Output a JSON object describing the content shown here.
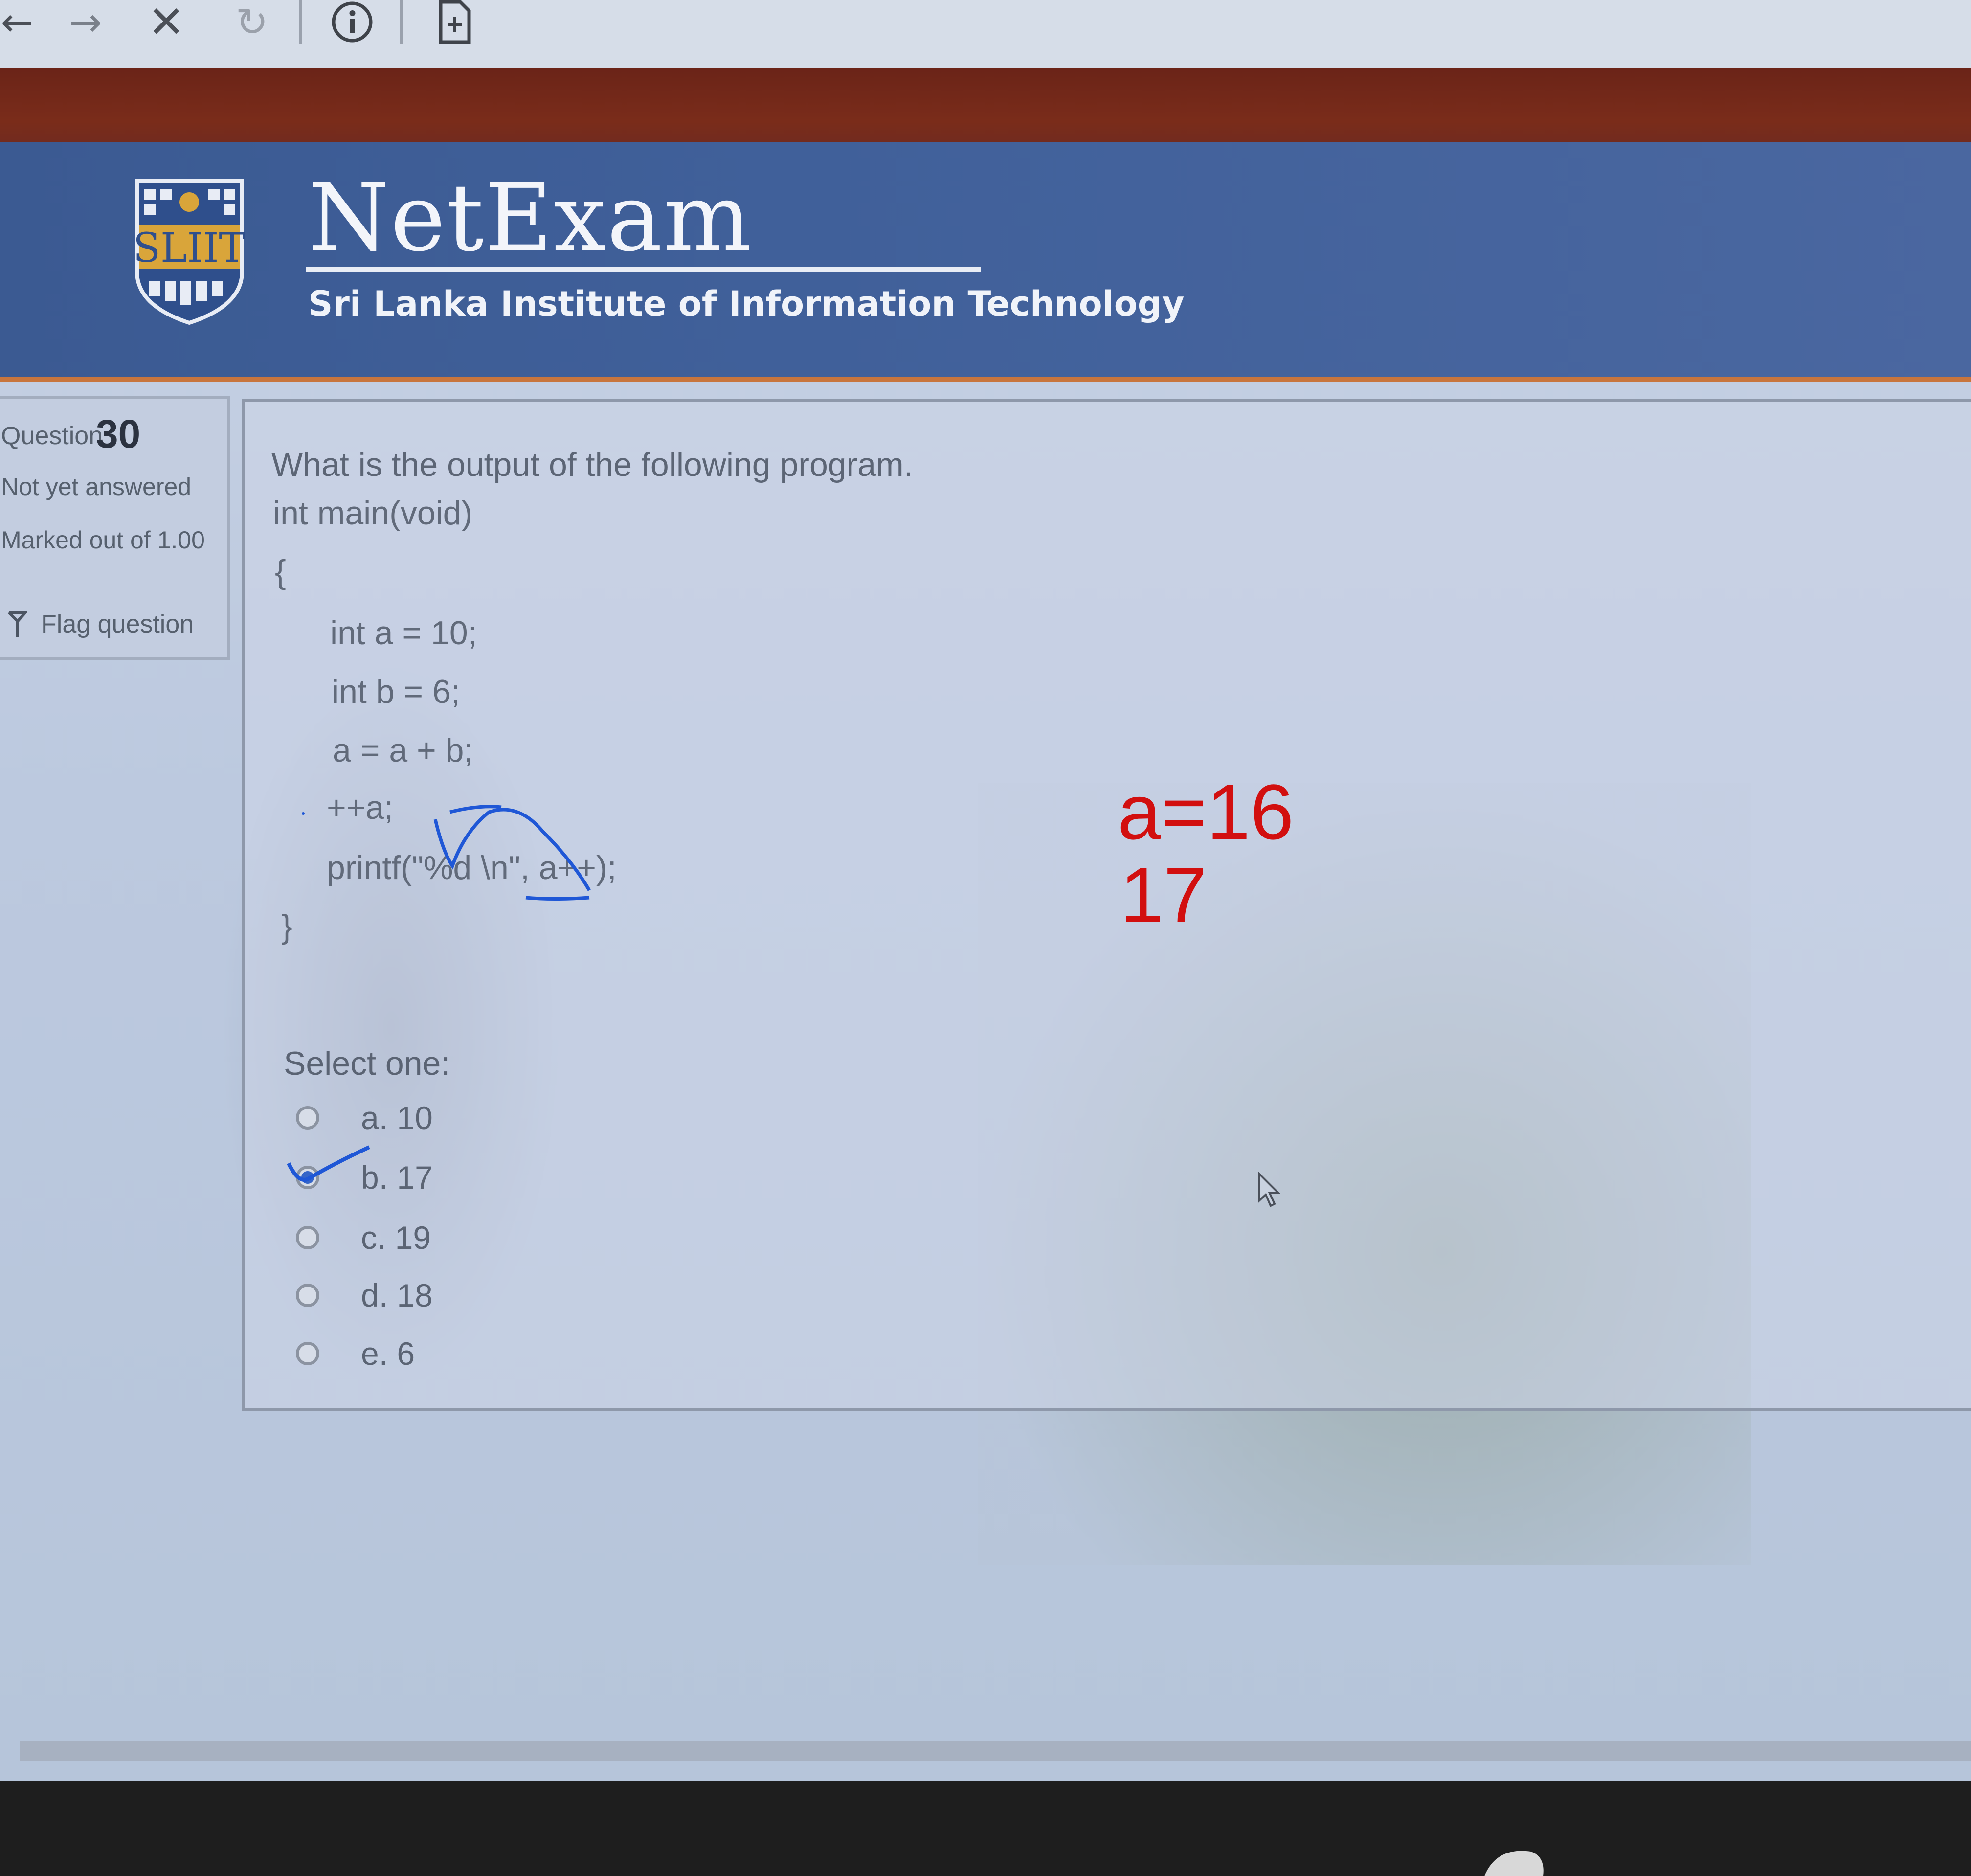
{
  "browser": {
    "icons": [
      "back-arrow-icon",
      "forward-arrow-icon",
      "close-icon",
      "reload-icon",
      "info-icon",
      "page-icon"
    ]
  },
  "header": {
    "logo_text": "SLIIT",
    "title": "NetExam",
    "subtitle": "Sri Lanka Institute of Information Technology"
  },
  "question_info": {
    "label": "Question",
    "number": "30",
    "status": "Not yet answered",
    "marked": "Marked out of 1.00",
    "flag_label": "Flag question"
  },
  "question": {
    "prompt": "What is the output of the following program.",
    "code": [
      "int main(void)",
      "{",
      "int a = 10;",
      "int b = 6;",
      "a = a + b;",
      "++a;",
      "printf(\"%d \\n\", a++);",
      "}"
    ],
    "select_label": "Select one:",
    "options": [
      {
        "label": "a. 10",
        "selected": false
      },
      {
        "label": "b. 17",
        "selected": true
      },
      {
        "label": "c. 19",
        "selected": false
      },
      {
        "label": "d. 18",
        "selected": false
      },
      {
        "label": "e. 6",
        "selected": false
      }
    ]
  },
  "annotations": {
    "red_line1": "a=16",
    "red_line2": "17",
    "red_color": "#d20f0f",
    "ink_color": "#1f57d6"
  }
}
